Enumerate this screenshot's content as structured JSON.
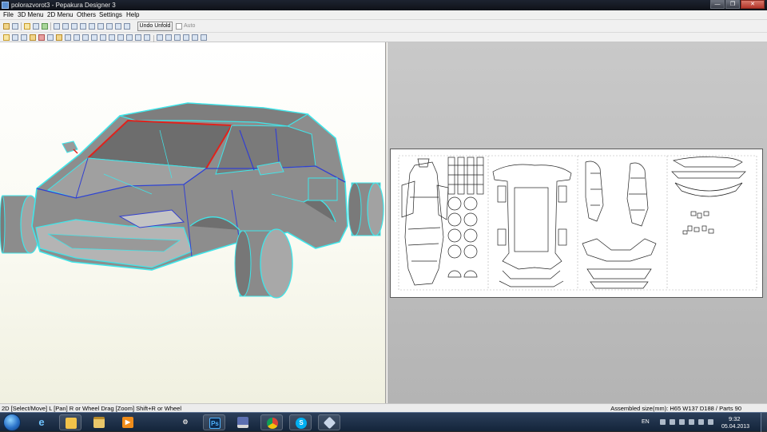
{
  "window": {
    "title": "polorazvorot3 - Pepakura Designer 3",
    "buttons": {
      "minimize": "—",
      "maximize": "❐",
      "close": "✕"
    }
  },
  "menu": {
    "items": [
      "File",
      "3D Menu",
      "2D Menu",
      "Others",
      "Settings",
      "Help"
    ]
  },
  "toolbar": {
    "undo_unfold_label": "Undo Unfold",
    "auto_label": "Auto",
    "auto_checked": false
  },
  "icons": {
    "open": "folder-icon",
    "save": "save-icon",
    "unfold": "unfold-icon",
    "texture": "texture-icon",
    "zoom": "zoom-icon"
  },
  "status": {
    "hint": "2D [Select/Move] L [Pan] R or Wheel Drag [Zoom] Shift+R or Wheel",
    "assembled": "Assembled size(mm): H65 W137 D188 / Parts 90"
  },
  "taskbar": {
    "language": "EN",
    "time": "9:32",
    "date": "05.04.2013",
    "apps": [
      "internet-explorer",
      "file-manager",
      "file-explorer",
      "media-player",
      "network-tool",
      "photoshop",
      "floppy-save",
      "chrome",
      "skype",
      "pepakura"
    ],
    "photoshop_label": "Ps",
    "skype_label": "S"
  },
  "colors": {
    "model_edge": "#3fe6ea",
    "model_fold": "#3340d0",
    "model_cut": "#e0221c",
    "model_body": "#8e8e8e"
  }
}
